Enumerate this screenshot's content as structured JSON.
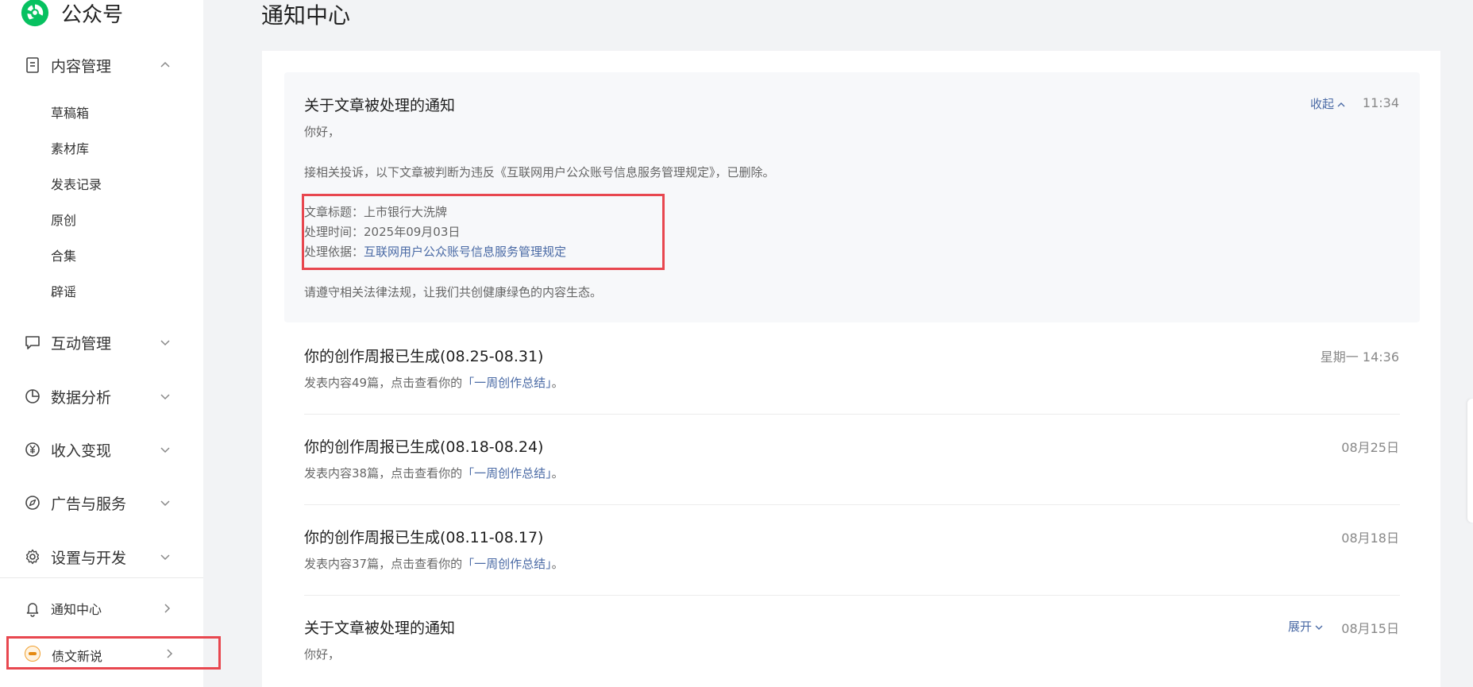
{
  "brand": {
    "name": "公众号",
    "accent": "#07c160"
  },
  "sidebar": {
    "content_mgmt": {
      "label": "内容管理",
      "icon": "document-icon",
      "sub_items": [
        "草稿箱",
        "素材库",
        "发表记录",
        "原创",
        "合集",
        "辟谣"
      ]
    },
    "groups": [
      {
        "label": "互动管理",
        "icon": "message-icon"
      },
      {
        "label": "数据分析",
        "icon": "pie-chart-icon"
      },
      {
        "label": "收入变现",
        "icon": "yen-icon"
      },
      {
        "label": "广告与服务",
        "icon": "compass-icon"
      },
      {
        "label": "设置与开发",
        "icon": "gear-icon"
      }
    ],
    "notice_center": "通知中心",
    "account_name": "债文新说"
  },
  "page": {
    "title": "通知中心"
  },
  "notices": [
    {
      "title": "关于文章被处理的通知",
      "time": "11:34",
      "toggle": "收起",
      "greeting": "你好，",
      "body": "接相关投诉，以下文章被判断为违反《互联网用户公众账号信息服务管理规定》，已删除。",
      "detail_title_label": "文章标题：",
      "detail_title_value": "上市银行大洗牌",
      "detail_time_label": "处理时间：",
      "detail_time_value": "2025年09月03日",
      "detail_basis_label": "处理依据：",
      "detail_basis_value": "互联网用户公众账号信息服务管理规定",
      "footer": "请遵守相关法律法规，让我们共创健康绿色的内容生态。"
    },
    {
      "title": "你的创作周报已生成(08.25-08.31)",
      "time": "星期一 14:36",
      "desc_prefix": "发表内容49篇，点击查看你的",
      "desc_link": "「一周创作总结」",
      "desc_suffix": "。"
    },
    {
      "title": "你的创作周报已生成(08.18-08.24)",
      "time": "08月25日",
      "desc_prefix": "发表内容38篇，点击查看你的",
      "desc_link": "「一周创作总结」",
      "desc_suffix": "。"
    },
    {
      "title": "你的创作周报已生成(08.11-08.17)",
      "time": "08月18日",
      "desc_prefix": "发表内容37篇，点击查看你的",
      "desc_link": "「一周创作总结」",
      "desc_suffix": "。"
    },
    {
      "title": "关于文章被处理的通知",
      "time": "08月15日",
      "toggle": "展开",
      "greeting": "你好，"
    }
  ],
  "colors": {
    "highlight_border": "#e8474f",
    "link": "#4a6aa5"
  }
}
